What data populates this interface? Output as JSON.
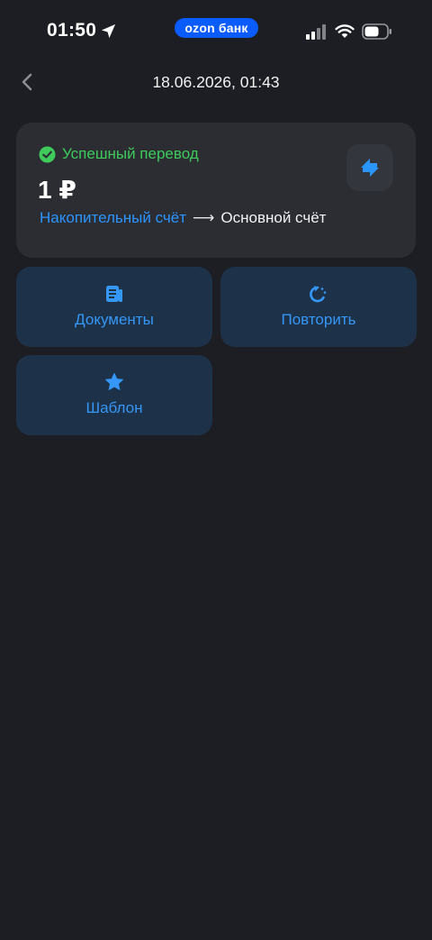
{
  "status_bar": {
    "time": "01:50",
    "brand_pill": "ozon банк"
  },
  "header": {
    "title": "18.06.2026, 01:43"
  },
  "transfer": {
    "status": "Успешный перевод",
    "amount": "1 ₽",
    "from": "Накопительный счёт",
    "arrow": "⟶",
    "to": "Основной счёт"
  },
  "actions": {
    "documents": "Документы",
    "repeat": "Повторить",
    "template": "Шаблон"
  },
  "colors": {
    "background": "#1c1e24",
    "card": "#2b2d33",
    "success": "#3ecb5c",
    "accent": "#2a95ff",
    "tile": "#1d3149",
    "brand": "#0b5cff"
  },
  "icons": [
    "location-arrow-icon",
    "signal-icon",
    "wifi-icon",
    "battery-icon",
    "chevron-left-icon",
    "check-circle-icon",
    "transfer-arrows-icon",
    "document-icon",
    "repeat-icon",
    "star-icon"
  ]
}
